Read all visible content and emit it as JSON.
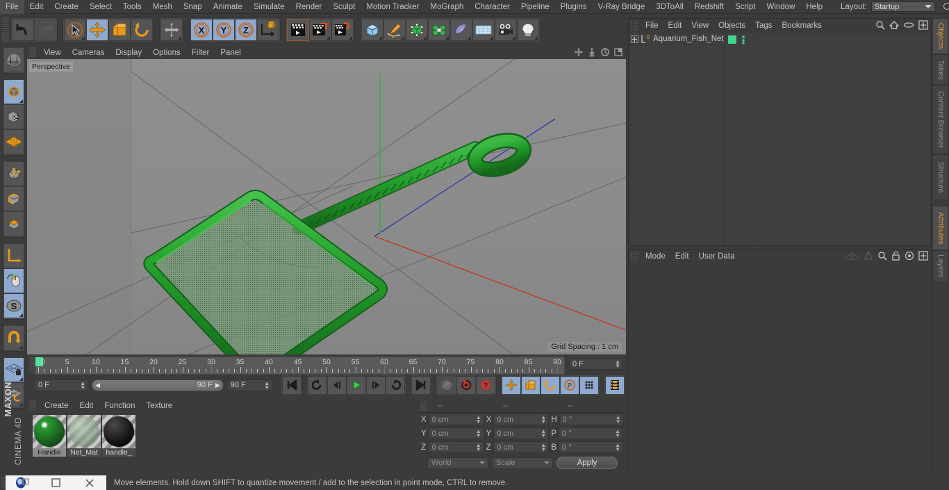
{
  "app": {
    "name": "CINEMA 4D",
    "brand": "MAXON",
    "brand_sub": "CINEMA 4D"
  },
  "menubar": {
    "items": [
      "File",
      "Edit",
      "Create",
      "Select",
      "Tools",
      "Mesh",
      "Snap",
      "Animate",
      "Simulate",
      "Render",
      "Sculpt",
      "Motion Tracker",
      "MoGraph",
      "Character",
      "Pipeline",
      "Plugins",
      "V-Ray Bridge",
      "3DToAll",
      "Redshift",
      "Script",
      "Window",
      "Help"
    ],
    "layout_label": "Layout:",
    "layout_value": "Startup",
    "search_icon": "search-icon"
  },
  "toolbar": {
    "groups": [
      {
        "name": "history",
        "buttons": [
          {
            "name": "undo-button",
            "icon": "undo-icon",
            "active": false,
            "dim": false
          },
          {
            "name": "redo-button",
            "icon": "redo-icon",
            "active": false,
            "dim": true
          }
        ]
      },
      {
        "name": "transform-tools",
        "buttons": [
          {
            "name": "live-selection-tool",
            "icon": "cursor-circle-icon",
            "active": false,
            "corner": true
          },
          {
            "name": "move-tool",
            "icon": "move-arrows-icon",
            "active": true
          },
          {
            "name": "scale-tool",
            "icon": "scale-box-icon",
            "active": false
          },
          {
            "name": "rotate-tool",
            "icon": "rotate-arc-icon",
            "active": false
          }
        ]
      },
      {
        "name": "magnet-group",
        "buttons": [
          {
            "name": "free-move-tool",
            "icon": "move-arrows-icon",
            "active": false,
            "corner": true
          }
        ]
      },
      {
        "name": "axis-locks",
        "buttons": [
          {
            "name": "lock-x-axis",
            "icon": "x-axis-icon",
            "active": true,
            "label": "X"
          },
          {
            "name": "lock-y-axis",
            "icon": "y-axis-icon",
            "active": true,
            "label": "Y"
          },
          {
            "name": "lock-z-axis",
            "icon": "z-axis-icon",
            "active": true,
            "label": "Z"
          },
          {
            "name": "world-object-coordinates",
            "icon": "world-axis-cube-icon",
            "active": false
          }
        ]
      },
      {
        "name": "render-group",
        "buttons": [
          {
            "name": "render-view-button",
            "icon": "render-view-icon",
            "active": false
          },
          {
            "name": "render-region-button",
            "icon": "render-region-icon",
            "active": false,
            "corner": true
          },
          {
            "name": "render-settings-button",
            "icon": "render-settings-gear-icon",
            "active": false,
            "corner": true
          }
        ]
      },
      {
        "name": "create-group",
        "buttons": [
          {
            "name": "add-primitive-cube",
            "icon": "cube-icon",
            "active": false,
            "corner": true
          },
          {
            "name": "add-spline-pen",
            "icon": "pen-spline-icon",
            "active": false,
            "corner": true
          },
          {
            "name": "add-generator",
            "icon": "generator-cube-icon",
            "active": false,
            "corner": true
          },
          {
            "name": "add-deformer",
            "icon": "deformer-icon",
            "active": false,
            "corner": true
          },
          {
            "name": "add-scene-environment",
            "icon": "environment-icon",
            "active": false,
            "corner": true
          },
          {
            "name": "add-floor-plane",
            "icon": "floor-grid-icon",
            "active": false,
            "corner": true
          },
          {
            "name": "add-camera",
            "icon": "camera-icon",
            "active": false,
            "corner": true
          },
          {
            "name": "add-light",
            "icon": "light-bulb-icon",
            "active": false,
            "corner": true
          }
        ]
      }
    ]
  },
  "leftbar": {
    "items": [
      {
        "name": "make-editable-button",
        "icon": "globe-wire-icon",
        "active": false
      },
      {
        "name": "model-mode-button",
        "icon": "model-cube-icon",
        "active": true,
        "corner": true
      },
      {
        "name": "texture-mode-button",
        "icon": "texture-cube-icon",
        "active": false
      },
      {
        "name": "workplane-mode-button",
        "icon": "workplane-grid-icon",
        "active": false
      },
      {
        "name": "points-mode-button",
        "icon": "points-cube-icon",
        "active": false
      },
      {
        "name": "edges-mode-button",
        "icon": "edges-cube-icon",
        "active": false
      },
      {
        "name": "polygons-mode-button",
        "icon": "polygons-cube-icon",
        "active": false
      },
      {
        "name": "axis-mode-button",
        "icon": "axis-l-icon",
        "active": false
      },
      {
        "name": "viewport-solo-button",
        "icon": "mouse-icon",
        "active": true
      },
      {
        "name": "enable-axis-button",
        "icon": "s-circle-icon",
        "active": true,
        "corner": true
      },
      {
        "name": "enable-snapping-button",
        "icon": "magnet-icon",
        "active": false,
        "corner": true
      },
      {
        "name": "workplane-lock-button",
        "icon": "grid-lock-icon",
        "active": true,
        "corner": true
      },
      {
        "name": "planar-workplane-button",
        "icon": "grid-rotate-icon",
        "active": false,
        "corner": true
      }
    ]
  },
  "viewport": {
    "tabs": [
      "View",
      "Cameras",
      "Display",
      "Options",
      "Filter",
      "Panel"
    ],
    "corner_icons": [
      "move-view-icon",
      "pan-view-icon",
      "rotate-view-icon",
      "maximize-view-icon"
    ],
    "label": "Perspective",
    "grid_spacing": "Grid Spacing : 1 cm",
    "axis_gizmo": {
      "x": "X",
      "y": "Y",
      "z": "Z",
      "x_color": "#d43c3c",
      "y_color": "#3cc43c",
      "z_color": "#3c5fd4"
    },
    "background_top": "#8d8d8d",
    "background_bottom": "#8a8a8a",
    "model": {
      "name": "Aquarium_Fish_Net",
      "frame_color": "#1f9a26",
      "frame_color_light": "#34b33a",
      "mesh_color": "#6d9a6d",
      "handle_color": "#1d8f24"
    },
    "world_axes": {
      "x_line": "#c0392b",
      "z_line": "#2c3fa8",
      "grid_line": "#555555"
    }
  },
  "timeline": {
    "playhead_frame": "0",
    "ruler_min": 0,
    "ruler_max": 90,
    "ruler_labels": [
      "0",
      "5",
      "10",
      "15",
      "20",
      "25",
      "30",
      "35",
      "40",
      "45",
      "50",
      "55",
      "60",
      "65",
      "70",
      "75",
      "80",
      "85",
      "90"
    ],
    "current_frame_field": "0 F",
    "frame_right_field": "0 F",
    "range_start": "0 F",
    "range_end": "90 F",
    "end_frame_field": "90 F",
    "buttons": [
      {
        "name": "go-to-start-button",
        "icon": "skip-start-icon",
        "active": false
      },
      {
        "name": "play-backwards-button",
        "icon": "loop-back-icon",
        "active": false
      },
      {
        "name": "step-back-button",
        "icon": "step-back-icon",
        "active": false
      },
      {
        "name": "play-forward-button",
        "icon": "play-icon",
        "active": false
      },
      {
        "name": "step-forward-button",
        "icon": "step-forward-icon",
        "active": false
      },
      {
        "name": "play-loop-button",
        "icon": "loop-forward-icon",
        "active": false
      },
      {
        "name": "go-to-end-button",
        "icon": "skip-end-icon",
        "active": false
      },
      {
        "name": "record-active-objects-button",
        "icon": "key-icon",
        "active": false,
        "dim": true
      },
      {
        "name": "autokeying-button",
        "icon": "record-circle-icon",
        "active": false,
        "color": "#c0392b"
      },
      {
        "name": "keyframe-selection-button",
        "icon": "question-circle-icon",
        "active": false,
        "color": "#c0392b"
      },
      {
        "name": "position-key-button",
        "icon": "move-arrows-icon",
        "active": true
      },
      {
        "name": "scale-key-button",
        "icon": "scale-box-icon",
        "active": true
      },
      {
        "name": "rotation-key-button",
        "icon": "rotate-arc-icon",
        "active": true
      },
      {
        "name": "param-key-button",
        "icon": "p-circle-icon",
        "active": true
      },
      {
        "name": "pla-key-button",
        "icon": "dots-grid-icon",
        "active": true
      },
      {
        "name": "film-strip-button",
        "icon": "film-strip-icon",
        "active": true
      }
    ]
  },
  "material_manager": {
    "tabs": [
      "Create",
      "Edit",
      "Function",
      "Texture"
    ],
    "materials": [
      {
        "name": "Handle",
        "color": "#2b9b33",
        "selected": true,
        "type": "solid"
      },
      {
        "name": "Net_Mat",
        "color": "#7d9a7d",
        "selected": false,
        "type": "transparent"
      },
      {
        "name": "handle_",
        "color": "#141414",
        "selected": false,
        "type": "solid"
      }
    ]
  },
  "coordinates": {
    "header_dashes": [
      "--",
      "--",
      "--"
    ],
    "rows": [
      {
        "pos_axis": "X",
        "pos_value": "0 cm",
        "size_axis": "X",
        "size_value": "0 cm",
        "rot_axis": "H",
        "rot_value": "0 °"
      },
      {
        "pos_axis": "Y",
        "pos_value": "0 cm",
        "size_axis": "Y",
        "size_value": "0 cm",
        "rot_axis": "P",
        "rot_value": "0 °"
      },
      {
        "pos_axis": "Z",
        "pos_value": "0 cm",
        "size_axis": "Z",
        "size_value": "0 cm",
        "rot_axis": "B",
        "rot_value": "0 °"
      }
    ],
    "coord_system": "World",
    "transform_mode": "Scale",
    "apply_label": "Apply"
  },
  "object_manager": {
    "tabs": [
      "File",
      "Edit",
      "View",
      "Objects",
      "Tags",
      "Bookmarks"
    ],
    "header_icons": [
      "search-icon",
      "home-icon",
      "eye-icon",
      "plus-box-icon"
    ],
    "objects": [
      {
        "name": "Aquarium_Fish_Net",
        "layer_badge": "0",
        "tag_color": "#3dd68c",
        "expanded": false
      }
    ]
  },
  "attribute_manager": {
    "tabs": [
      "Mode",
      "Edit",
      "User Data"
    ],
    "header_icons": [
      "mesh-arrow-icon",
      "cone-icon",
      "search-icon",
      "lock-icon",
      "target-icon",
      "plus-box-icon"
    ]
  },
  "right_tabs": {
    "top": [
      {
        "label": "Objects",
        "active": true
      },
      {
        "label": "Takes",
        "active": false
      },
      {
        "label": "Content Browser",
        "active": false
      },
      {
        "label": "Structure",
        "active": false
      }
    ],
    "bottom": [
      {
        "label": "Attributes",
        "active": true
      },
      {
        "label": "Layers",
        "active": false
      }
    ]
  },
  "statusbar": {
    "text": "Move elements. Hold down SHIFT to quantize movement / add to the selection in point mode, CTRL to remove."
  },
  "window_controls": {
    "icons": [
      "restore-icon",
      "minimize-icon",
      "close-icon"
    ]
  },
  "colors": {
    "chrome": "#3b3b3b",
    "panel": "#4a4a4a",
    "accent_blue": "#8fa9cf",
    "accent_orange": "#d39a3a",
    "text": "#c2c2c2",
    "viewport_bg": "#8a8a8a"
  }
}
